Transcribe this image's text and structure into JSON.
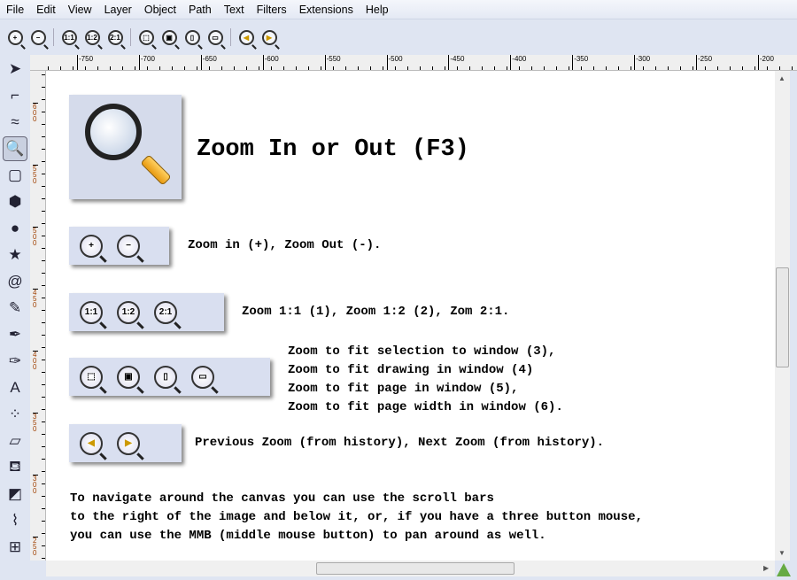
{
  "menubar": [
    "File",
    "Edit",
    "View",
    "Layer",
    "Object",
    "Path",
    "Text",
    "Filters",
    "Extensions",
    "Help"
  ],
  "toolbar": [
    {
      "icon": "zoom-in-icon",
      "glyph": "+"
    },
    {
      "icon": "zoom-out-icon",
      "glyph": "−"
    },
    {
      "icon": "zoom-1-1-icon",
      "glyph": "1:1"
    },
    {
      "icon": "zoom-1-2-icon",
      "glyph": "1:2"
    },
    {
      "icon": "zoom-2-1-icon",
      "glyph": "2:1"
    },
    {
      "icon": "zoom-selection-icon",
      "glyph": "⬚"
    },
    {
      "icon": "zoom-drawing-icon",
      "glyph": "▣"
    },
    {
      "icon": "zoom-page-icon",
      "glyph": "▯"
    },
    {
      "icon": "zoom-page-width-icon",
      "glyph": "▭"
    },
    {
      "icon": "zoom-previous-icon",
      "glyph": "◀"
    },
    {
      "icon": "zoom-next-icon",
      "glyph": "▶"
    }
  ],
  "tools": [
    {
      "icon": "selector-tool-icon",
      "glyph": "➤"
    },
    {
      "icon": "node-tool-icon",
      "glyph": "⌐"
    },
    {
      "icon": "tweak-tool-icon",
      "glyph": "≈"
    },
    {
      "icon": "zoom-tool-icon",
      "glyph": "🔍",
      "active": true
    },
    {
      "icon": "rectangle-tool-icon",
      "glyph": "▢"
    },
    {
      "icon": "3d-box-tool-icon",
      "glyph": "⬢"
    },
    {
      "icon": "ellipse-tool-icon",
      "glyph": "●"
    },
    {
      "icon": "star-tool-icon",
      "glyph": "★"
    },
    {
      "icon": "spiral-tool-icon",
      "glyph": "@"
    },
    {
      "icon": "pencil-tool-icon",
      "glyph": "✎"
    },
    {
      "icon": "pen-tool-icon",
      "glyph": "✒"
    },
    {
      "icon": "calligraphy-tool-icon",
      "glyph": "✑"
    },
    {
      "icon": "text-tool-icon",
      "glyph": "A"
    },
    {
      "icon": "spray-tool-icon",
      "glyph": "⁘"
    },
    {
      "icon": "eraser-tool-icon",
      "glyph": "▱"
    },
    {
      "icon": "paint-bucket-tool-icon",
      "glyph": "⛾"
    },
    {
      "icon": "gradient-tool-icon",
      "glyph": "◩"
    },
    {
      "icon": "dropper-tool-icon",
      "glyph": "⌇"
    },
    {
      "icon": "connector-tool-icon",
      "glyph": "⊞"
    }
  ],
  "hruler": [
    "-750",
    "-700",
    "-650",
    "-600",
    "-550",
    "-500",
    "-450",
    "-400",
    "-350",
    "-300",
    "-250",
    "-200"
  ],
  "vruler": [
    "600",
    "550",
    "500",
    "450",
    "400",
    "350",
    "300",
    "250"
  ],
  "content": {
    "title": "Zoom In or Out (F3)",
    "line1": "Zoom in (+), Zoom Out (-).",
    "line2": "Zoom 1:1 (1), Zoom 1:2 (2), Zom 2:1.",
    "line3": [
      "Zoom to fit selection to window (3),",
      "Zoom to fit drawing in window (4)",
      "Zoom to fit page in window (5),",
      "Zoom to fit page width in window (6)."
    ],
    "line4": "Previous Zoom (from history), Next Zoom (from history).",
    "para": [
      "To navigate around the canvas you can use the scroll bars",
      "to the right of the image and below it, or, if you have a three button mouse,",
      "you can use the MMB (middle mouse button) to pan around as well."
    ]
  }
}
